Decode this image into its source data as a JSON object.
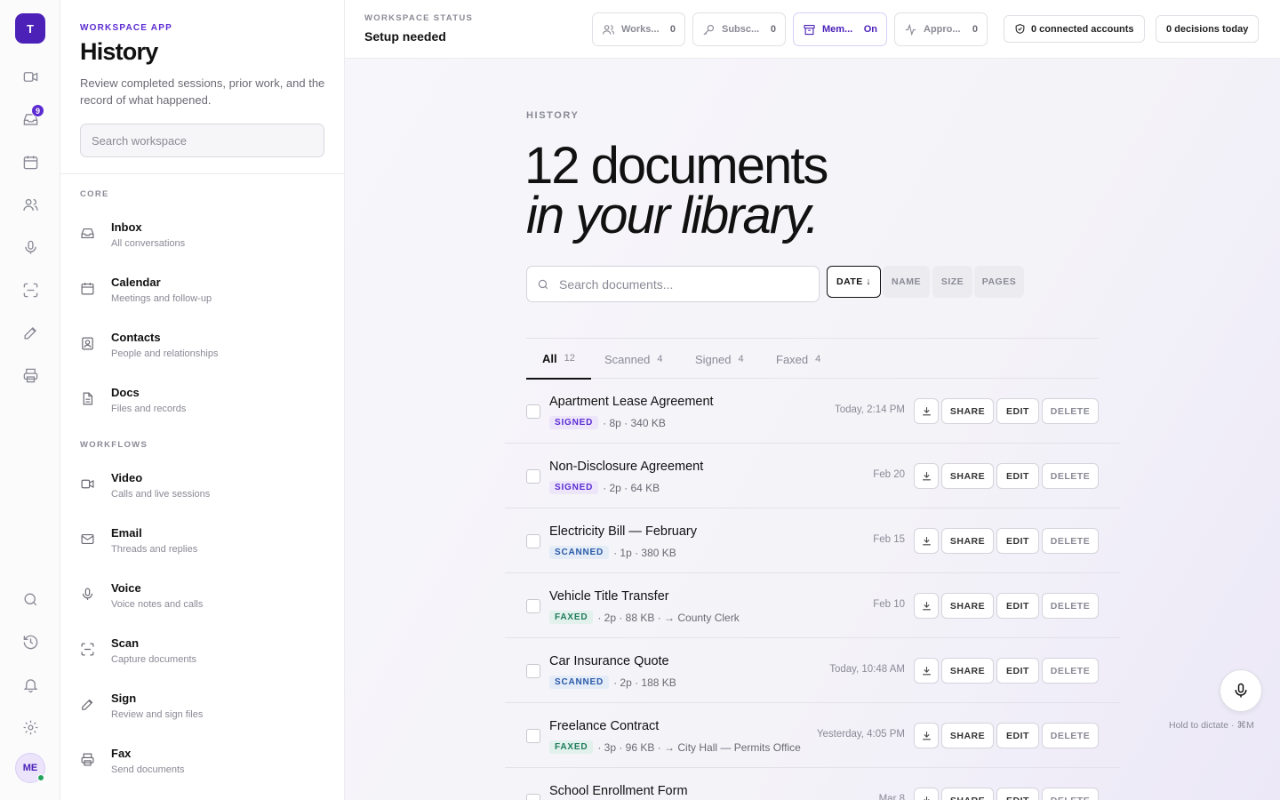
{
  "rail": {
    "logo": "T",
    "inbox_badge": "9",
    "avatar": "ME"
  },
  "sidebar": {
    "eyebrow": "WORKSPACE APP",
    "title": "History",
    "description": "Review completed sessions, prior work, and the record of what happened.",
    "search_placeholder": "Search workspace",
    "sections": [
      {
        "label": "CORE",
        "items": [
          {
            "title": "Inbox",
            "subtitle": "All conversations",
            "icon": "inbox-icon"
          },
          {
            "title": "Calendar",
            "subtitle": "Meetings and follow-up",
            "icon": "calendar-icon"
          },
          {
            "title": "Contacts",
            "subtitle": "People and relationships",
            "icon": "contacts-icon"
          },
          {
            "title": "Docs",
            "subtitle": "Files and records",
            "icon": "docs-icon"
          }
        ]
      },
      {
        "label": "WORKFLOWS",
        "items": [
          {
            "title": "Video",
            "subtitle": "Calls and live sessions",
            "icon": "video-icon"
          },
          {
            "title": "Email",
            "subtitle": "Threads and replies",
            "icon": "email-icon"
          },
          {
            "title": "Voice",
            "subtitle": "Voice notes and calls",
            "icon": "mic-icon"
          },
          {
            "title": "Scan",
            "subtitle": "Capture documents",
            "icon": "scan-icon"
          },
          {
            "title": "Sign",
            "subtitle": "Review and sign files",
            "icon": "pen-icon"
          },
          {
            "title": "Fax",
            "subtitle": "Send documents",
            "icon": "printer-icon"
          }
        ]
      }
    ]
  },
  "topbar": {
    "label": "WORKSPACE STATUS",
    "status": "Setup needed",
    "pills": [
      {
        "label": "Works...",
        "value": "0",
        "icon": "users-icon",
        "active": false
      },
      {
        "label": "Subsc...",
        "value": "0",
        "icon": "key-icon",
        "active": false
      },
      {
        "label": "Mem...",
        "value": "On",
        "icon": "archive-icon",
        "active": true
      },
      {
        "label": "Appro...",
        "value": "0",
        "icon": "activity-icon",
        "active": false
      }
    ],
    "connected_accounts": "0 connected accounts",
    "decisions": "0 decisions today"
  },
  "main": {
    "eyebrow": "HISTORY",
    "hero_line1": "12 documents",
    "hero_line2": "in your library.",
    "search_placeholder": "Search documents...",
    "sort": [
      {
        "label": "DATE ↓",
        "active": true
      },
      {
        "label": "NAME",
        "active": false
      },
      {
        "label": "SIZE",
        "active": false
      },
      {
        "label": "PAGES",
        "active": false
      }
    ],
    "tabs": [
      {
        "label": "All",
        "count": "12",
        "active": true
      },
      {
        "label": "Scanned",
        "count": "4",
        "active": false
      },
      {
        "label": "Signed",
        "count": "4",
        "active": false
      },
      {
        "label": "Faxed",
        "count": "4",
        "active": false
      }
    ],
    "actions": {
      "share": "SHARE",
      "edit": "EDIT",
      "delete": "DELETE"
    },
    "documents": [
      {
        "name": "Apartment Lease Agreement",
        "tag": "SIGNED",
        "meta": "· 8p · 340 KB",
        "date": "Today, 2:14 PM"
      },
      {
        "name": "Non-Disclosure Agreement",
        "tag": "SIGNED",
        "meta": "· 2p · 64 KB",
        "date": "Feb 20"
      },
      {
        "name": "Electricity Bill — February",
        "tag": "SCANNED",
        "meta": "· 1p · 380 KB",
        "date": "Feb 15"
      },
      {
        "name": "Vehicle Title Transfer",
        "tag": "FAXED",
        "meta": "· 2p · 88 KB · → County Clerk",
        "date": "Feb 10"
      },
      {
        "name": "Car Insurance Quote",
        "tag": "SCANNED",
        "meta": "· 2p · 188 KB",
        "date": "Today, 10:48 AM"
      },
      {
        "name": "Freelance Contract",
        "tag": "FAXED",
        "meta": "· 3p · 96 KB · → City Hall — Permits Office",
        "date": "Yesterday, 4:05 PM"
      },
      {
        "name": "School Enrollment Form",
        "tag": "",
        "meta": "",
        "date": "Mar 8"
      }
    ],
    "dictate_hint": "Hold to dictate · ⌘M"
  }
}
